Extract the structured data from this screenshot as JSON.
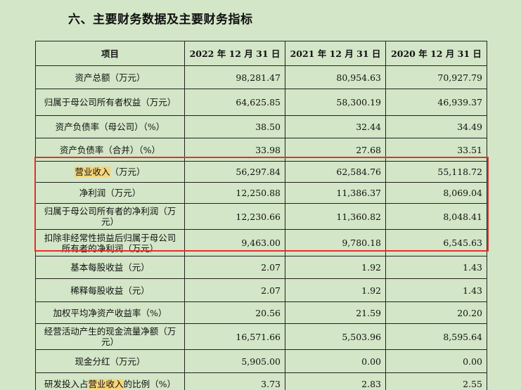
{
  "section_title": "六、主要财务数据及主要财务指标",
  "table": {
    "headers": [
      "项目",
      "2022 年 12 月 31 日",
      "2021 年 12 月 31 日",
      "2020 年 12 月 31 日"
    ],
    "rows": [
      {
        "label": "资产总额（万元）",
        "values": [
          "98,281.47",
          "80,954.63",
          "70,927.79"
        ]
      },
      {
        "label": "归属于母公司所有者权益（万元）",
        "values": [
          "64,625.85",
          "58,300.19",
          "46,939.37"
        ]
      },
      {
        "label": "资产负债率（母公司）（%）",
        "values": [
          "38.50",
          "32.44",
          "34.49"
        ]
      },
      {
        "label": "资产负债率（合并）（%）",
        "values": [
          "33.98",
          "27.68",
          "33.51"
        ]
      },
      {
        "label_highlight": "营业收入",
        "label_rest": "（万元）",
        "values": [
          "56,297.84",
          "62,584.76",
          "55,118.72"
        ]
      },
      {
        "label": "净利润（万元）",
        "values": [
          "12,250.88",
          "11,386.37",
          "8,069.04"
        ]
      },
      {
        "label": "归属于母公司所有者的净利润（万元）",
        "values": [
          "12,230.66",
          "11,360.82",
          "8,048.41"
        ]
      },
      {
        "label": "扣除非经常性损益后归属于母公司所有者的净利润（万元）",
        "values": [
          "9,463.00",
          "9,780.18",
          "6,545.63"
        ]
      },
      {
        "label": "基本每股收益（元）",
        "values": [
          "2.07",
          "1.92",
          "1.43"
        ]
      },
      {
        "label": "稀释每股收益（元）",
        "values": [
          "2.07",
          "1.92",
          "1.43"
        ]
      },
      {
        "label": "加权平均净资产收益率（%）",
        "values": [
          "20.56",
          "21.59",
          "20.20"
        ]
      },
      {
        "label": "经营活动产生的现金流量净额（万元）",
        "values": [
          "16,571.66",
          "5,503.96",
          "8,595.64"
        ]
      },
      {
        "label": "现金分红（万元）",
        "values": [
          "5,905.00",
          "0.00",
          "0.00"
        ]
      },
      {
        "label_pre": "研发投入占",
        "label_highlight": "营业收入",
        "label_rest": "的比例（%）",
        "values": [
          "3.73",
          "2.83",
          "2.55"
        ]
      }
    ]
  },
  "colors": {
    "background": "#d3e6c7",
    "highlight": "#f6d57a",
    "box": "#e53030"
  }
}
